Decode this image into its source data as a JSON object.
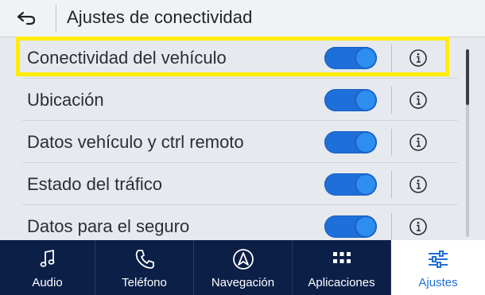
{
  "header": {
    "title": "Ajustes de conectividad",
    "back_icon": "back-arrow-icon"
  },
  "settings": [
    {
      "label": "Conectividad del vehículo",
      "enabled": true,
      "highlighted": true
    },
    {
      "label": "Ubicación",
      "enabled": true
    },
    {
      "label": "Datos vehículo y ctrl remoto",
      "enabled": true
    },
    {
      "label": "Estado del tráfico",
      "enabled": true
    },
    {
      "label": "Datos para el seguro",
      "enabled": true
    }
  ],
  "tabs": [
    {
      "label": "Audio",
      "icon": "music-note-icon"
    },
    {
      "label": "Teléfono",
      "icon": "phone-icon"
    },
    {
      "label": "Navegación",
      "icon": "navigation-arrow-icon"
    },
    {
      "label": "Aplicaciones",
      "icon": "apps-grid-icon"
    },
    {
      "label": "Ajustes",
      "icon": "settings-sliders-icon",
      "active": true
    }
  ],
  "colors": {
    "toggle_on": "#1e6fd9",
    "highlight": "#ffec00",
    "tabbar_bg": "#0b1f47",
    "active_tab_text": "#1f6fd6"
  }
}
